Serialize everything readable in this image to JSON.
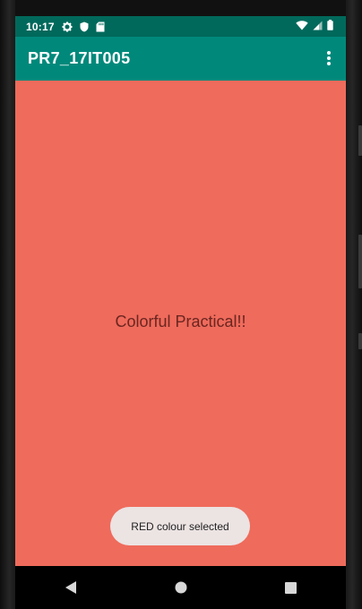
{
  "statusbar": {
    "time": "10:17",
    "left_icons": [
      "settings-icon",
      "shield-icon",
      "sd-card-icon"
    ],
    "right_icons": [
      "wifi-icon",
      "cellular-signal-icon",
      "battery-icon"
    ]
  },
  "appbar": {
    "title": "PR7_17IT005",
    "menu_icon": "overflow-menu-icon"
  },
  "main": {
    "text": "Colorful Practical!!",
    "background_color": "#EF6B5C"
  },
  "toast": {
    "message": "RED colour selected"
  },
  "navigation": {
    "buttons": [
      "back-icon",
      "home-icon",
      "recents-icon"
    ]
  },
  "colors": {
    "primary": "#00897B",
    "primary_dark": "#00695C",
    "content_bg": "#EF6B5C",
    "toast_bg": "#ECE3E3"
  }
}
